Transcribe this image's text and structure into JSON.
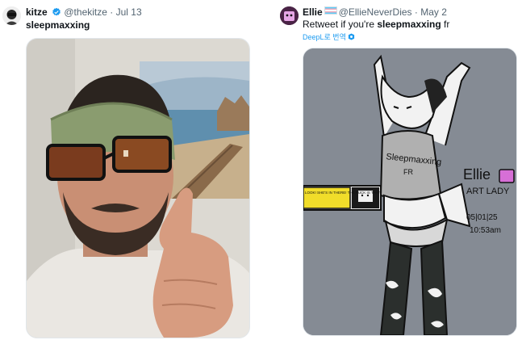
{
  "posts": [
    {
      "author": "kitze",
      "handle": "@thekitze",
      "date": "Jul 13",
      "verified": true,
      "text": "sleepmaxxing",
      "media": {
        "icons": [
          "sleep-mask",
          "sunglasses",
          "thumbs-up",
          "beach-poster"
        ],
        "colors": {
          "wall": "#d9d6cf",
          "mask": "#8a9c6f",
          "shirt": "#e9e6e1",
          "skin": "#c98f74"
        }
      }
    },
    {
      "author": "Ellie",
      "handle": "@EllieNeverDies",
      "date": "May 2",
      "verified": false,
      "text_prefix": "Retweet if you're ",
      "text_bold": "sleepmaxxing",
      "text_suffix": " fr",
      "translate_label": "DeepL로 번역",
      "media": {
        "drawing_texts": {
          "shirt": "Sleepmaxxing",
          "shirt_sub": "FR",
          "signature_name": "Ellie",
          "signature_title": "ART LADY",
          "signature_date": "05|01|25",
          "signature_time": "10:53am",
          "sign": "LOOK! SHE'S IN THERE! THE FUCK IS THAT! MMM HMM!"
        },
        "colors": {
          "background": "#858b94",
          "outline": "#111111"
        }
      }
    }
  ],
  "colors": {
    "accent": "#1d9bf0",
    "text": "#0f1419",
    "secondary": "#536471"
  }
}
